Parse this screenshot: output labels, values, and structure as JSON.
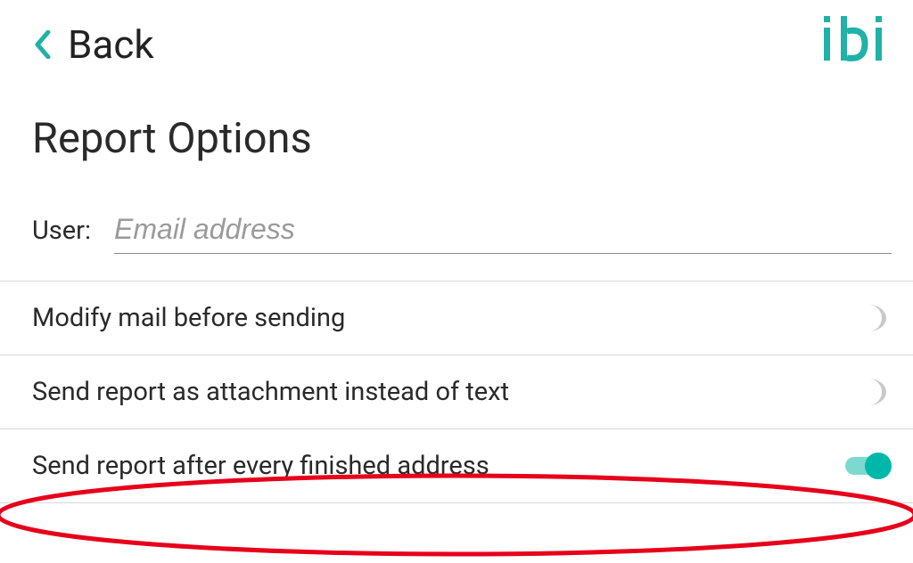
{
  "header": {
    "back_label": "Back",
    "logo_text": "ibi"
  },
  "title": "Report Options",
  "user": {
    "label": "User:",
    "placeholder": "Email address",
    "value": ""
  },
  "options": [
    {
      "label": "Modify mail before sending",
      "on": false
    },
    {
      "label": "Send report as attachment instead of text",
      "on": false
    },
    {
      "label": "Send report after every finished address",
      "on": true
    }
  ],
  "colors": {
    "accent": "#00b8a9",
    "accent_light": "#7cd9d0",
    "highlight": "#e6001a"
  }
}
